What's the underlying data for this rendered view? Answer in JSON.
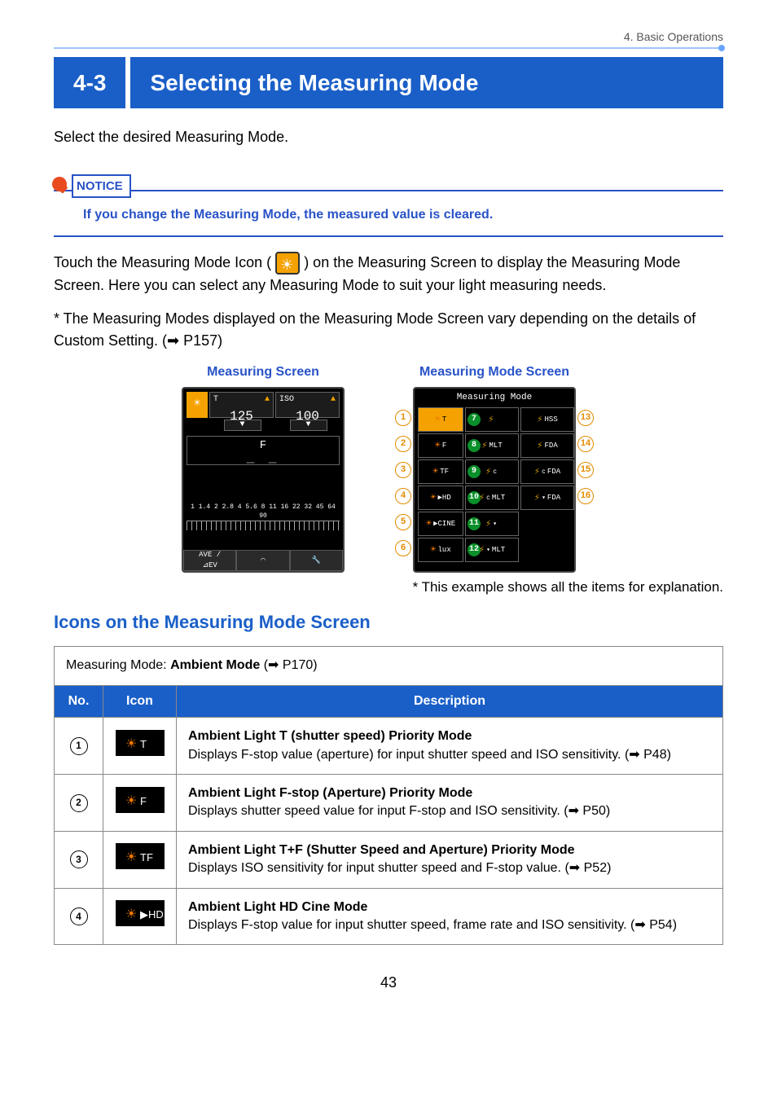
{
  "breadcrumb": "4.  Basic Operations",
  "section": {
    "number": "4-3",
    "title": "Selecting the Measuring Mode"
  },
  "intro": "Select the desired Measuring Mode.",
  "notice": {
    "label": "NOTICE",
    "text": "If you change the Measuring Mode, the measured value is cleared."
  },
  "para1_a": "Touch the Measuring Mode Icon (",
  "para1_b": ") on the Measuring Screen to display the Measuring Mode Screen. Here you can select any Measuring Mode to suit your light measuring needs.",
  "para2": "* The Measuring Modes displayed on the Measuring Mode Screen vary depending on the details of Custom Setting. (➡ P157)",
  "figcaps": {
    "left": "Measuring Screen",
    "right": "Measuring Mode Screen"
  },
  "measuring_screen": {
    "t_label": "T",
    "t_value": "125",
    "iso_label": "ISO",
    "iso_value": "100",
    "f_label": "F",
    "scale_nums": "1 1.4 2 2.8 4 5.6 8  11 16 22 32 45 64 90",
    "footer1": "AVE /\n⊿EV",
    "footer2": "◠",
    "footer3": "🔧"
  },
  "mode_screen": {
    "title": "Measuring Mode",
    "left_callouts": [
      "1",
      "2",
      "3",
      "4",
      "5",
      "6"
    ],
    "right_callouts": [
      "13",
      "14",
      "15",
      "16"
    ],
    "center_circles": [
      "7",
      "8",
      "9",
      "10",
      "11",
      "12"
    ],
    "rows": [
      {
        "c1": {
          "sun": true,
          "txt": "T",
          "hi": true
        },
        "c2": {
          "bolt": true,
          "txt": ""
        },
        "c3": {
          "bolt": true,
          "txt": "HSS"
        }
      },
      {
        "c1": {
          "sun": true,
          "txt": "F",
          "hi": false
        },
        "c2": {
          "bolt": true,
          "txt": "MLT"
        },
        "c3": {
          "bolt": true,
          "txt": "FDA"
        }
      },
      {
        "c1": {
          "sun": true,
          "txt": "TF"
        },
        "c2": {
          "bolt": true,
          "txt": "",
          "sub": "c"
        },
        "c3": {
          "bolt": true,
          "txt": "FDA",
          "sub": "c"
        }
      },
      {
        "c1": {
          "sun": true,
          "txt": "▶HD"
        },
        "c2": {
          "bolt": true,
          "txt": "MLT",
          "sub": "c"
        },
        "c3": {
          "bolt": true,
          "txt": "FDA",
          "sub": "▾"
        }
      },
      {
        "c1": {
          "sun": true,
          "txt": "▶CINE"
        },
        "c2": {
          "bolt": true,
          "txt": "",
          "sub": "▾"
        },
        "c3": null
      },
      {
        "c1": {
          "sun": true,
          "txt": "lux"
        },
        "c2": {
          "bolt": true,
          "txt": "MLT",
          "sub": "▾"
        },
        "c3": null
      }
    ]
  },
  "example_note": "* This example shows all the items for explanation.",
  "subheader": "Icons on the Measuring Mode Screen",
  "table_caption_a": "Measuring Mode: ",
  "table_caption_b": "Ambient Mode",
  "table_caption_c": " (➡ P170)",
  "table": {
    "headers": {
      "no": "No.",
      "icon": "Icon",
      "desc": "Description"
    },
    "rows": [
      {
        "num": "1",
        "icon_text": "T",
        "title": "Ambient Light T (shutter speed) Priority Mode",
        "body": "Displays F-stop value (aperture) for input shutter speed and ISO sensitivity. (➡ P48)"
      },
      {
        "num": "2",
        "icon_text": "F",
        "title": "Ambient Light F-stop (Aperture) Priority Mode",
        "body": "Displays shutter speed value for input F-stop and ISO sensitivity. (➡ P50)"
      },
      {
        "num": "3",
        "icon_text": "TF",
        "title": "Ambient Light T+F (Shutter Speed and Aperture) Priority Mode",
        "body": "Displays ISO sensitivity for input shutter speed and F-stop value. (➡ P52)"
      },
      {
        "num": "4",
        "icon_text": "▶HD",
        "title": "Ambient Light HD Cine Mode",
        "body": "Displays F-stop value for input shutter speed, frame rate and ISO sensitivity. (➡ P54)"
      }
    ]
  },
  "page_number": "43"
}
